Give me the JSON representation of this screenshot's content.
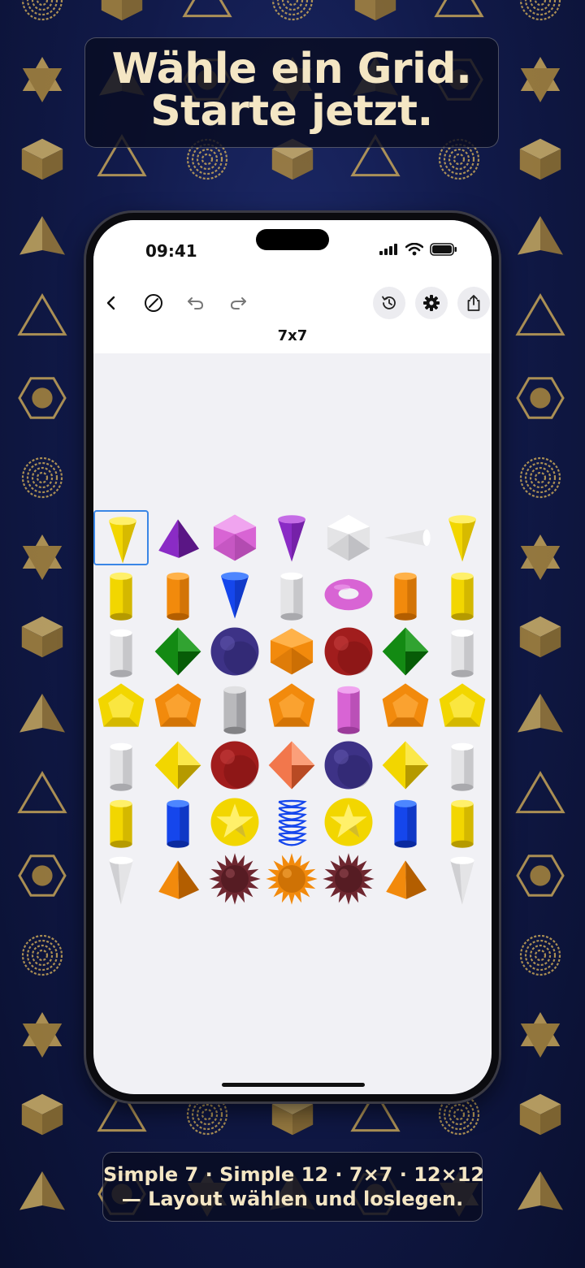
{
  "headline": {
    "line1": "Wähle ein Grid.",
    "line2": "Starte jetzt."
  },
  "status_bar": {
    "time": "09:41"
  },
  "toolbar": {
    "icons": [
      "back-icon",
      "clear-icon",
      "undo-icon",
      "redo-icon",
      "history-icon",
      "gear-icon",
      "share-icon"
    ]
  },
  "grid_title": "7x7",
  "board": {
    "rows": 7,
    "cols": 7,
    "selected_cell": [
      0,
      0
    ],
    "cells": [
      [
        "yellow-cone",
        "purple-pyramid",
        "pink-icosahedron",
        "purple-cone",
        "white-icosahedron",
        "white-cone-sideways",
        "yellow-cone"
      ],
      [
        "yellow-cylinder",
        "orange-cylinder",
        "blue-cone",
        "white-cylinder",
        "pink-torus",
        "orange-cylinder",
        "yellow-cylinder"
      ],
      [
        "white-cylinder",
        "green-octahedron",
        "navy-sphere",
        "orange-icosahedron",
        "red-sphere",
        "green-octahedron",
        "white-cylinder"
      ],
      [
        "yellow-dodecahedron",
        "orange-dodecahedron",
        "gray-cylinder",
        "orange-dodecahedron",
        "pink-cylinder",
        "orange-dodecahedron",
        "yellow-dodecahedron"
      ],
      [
        "white-cylinder",
        "yellow-octahedron",
        "red-sphere",
        "coral-octahedron",
        "navy-sphere",
        "yellow-octahedron",
        "white-cylinder"
      ],
      [
        "yellow-cylinder",
        "blue-cylinder",
        "yellow-star-sphere",
        "blue-spring",
        "yellow-star-sphere",
        "blue-cylinder",
        "yellow-cylinder"
      ],
      [
        "white-cone-down",
        "orange-pyramid",
        "maroon-spiky-ball",
        "orange-spiky-ball",
        "maroon-spiky-ball",
        "orange-pyramid",
        "white-cone-down"
      ]
    ]
  },
  "caption": {
    "line1": "Simple 7 · Simple 12 · 7×7 · 12×12",
    "line2": "— Layout wählen und loslegen."
  },
  "colors": {
    "background": "#111a4a",
    "gold": "#d6b15a",
    "headline_text": "#f4e6c4",
    "selection": "#3a86e6",
    "canvas": "#f1f1f5"
  }
}
